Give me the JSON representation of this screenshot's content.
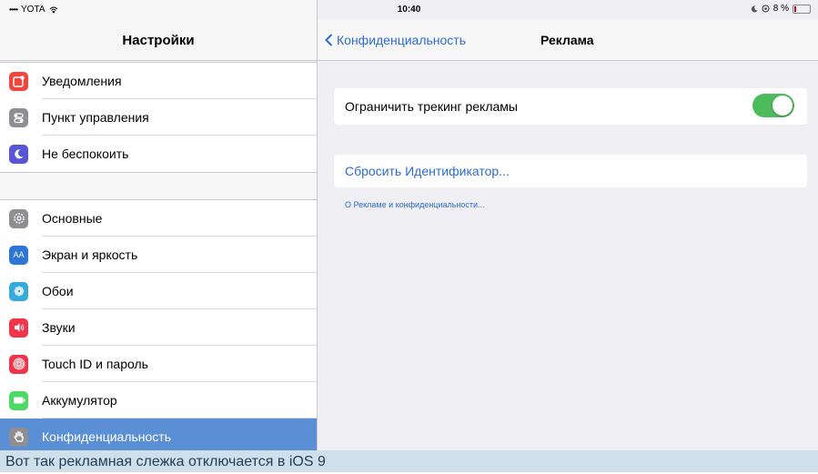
{
  "status_bar": {
    "signal_dots": "•••••",
    "carrier": "YOTA",
    "wifi_icon": "wifi-icon",
    "time": "10:40",
    "battery": "8 %",
    "battery_percent": 8
  },
  "sidebar": {
    "title": "Настройки",
    "group1": [
      {
        "label": "Уведомления",
        "icon": "notifications-icon",
        "color": "#f0463c"
      },
      {
        "label": "Пункт управления",
        "icon": "control-center-icon",
        "color": "#8e8e93"
      },
      {
        "label": "Не беспокоить",
        "icon": "moon-icon",
        "color": "#5856d6"
      }
    ],
    "group2": [
      {
        "label": "Основные",
        "icon": "gear-icon",
        "color": "#8e8e93"
      },
      {
        "label": "Экран и яркость",
        "icon": "display-icon",
        "color": "#2d75d6",
        "glyph": "AA"
      },
      {
        "label": "Обои",
        "icon": "wallpaper-icon",
        "color": "#36aadc"
      },
      {
        "label": "Звуки",
        "icon": "speaker-icon",
        "color": "#f0354a"
      },
      {
        "label": "Touch ID и пароль",
        "icon": "fingerprint-icon",
        "color": "#f0354a"
      },
      {
        "label": "Аккумулятор",
        "icon": "battery-icon",
        "color": "#4cd964"
      },
      {
        "label": "Конфиденциальность",
        "icon": "hand-icon",
        "color": "#8e8e93",
        "selected": true
      }
    ]
  },
  "detail": {
    "back_label": "Конфиденциальность",
    "title": "Реклама",
    "limit_tracking_label": "Ограничить трекинг рекламы",
    "limit_tracking_on": true,
    "reset_label": "Сбросить Идентификатор...",
    "about_label": "О Рекламе и конфиденциальности..."
  },
  "caption": "Вот так рекламная слежка отключается в iOS 9",
  "colors": {
    "accent": "#2b6cd4",
    "toggle_on": "#4cbb5c",
    "selected_row": "#5a8fd6"
  }
}
